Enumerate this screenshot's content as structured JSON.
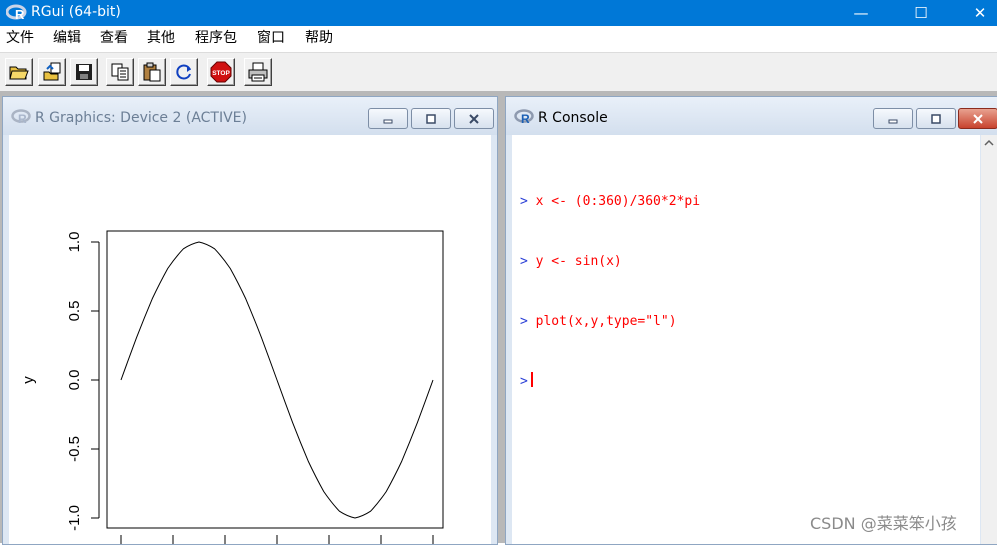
{
  "app": {
    "title": "RGui (64-bit)",
    "controls": {
      "minimize": "—",
      "maximize": "☐",
      "close": "✕"
    }
  },
  "menu": [
    {
      "label": "文件"
    },
    {
      "label": "编辑"
    },
    {
      "label": "查看"
    },
    {
      "label": "其他"
    },
    {
      "label": "程序包"
    },
    {
      "label": "窗口"
    },
    {
      "label": "帮助"
    }
  ],
  "toolbar": [
    {
      "icon": "open-script-icon"
    },
    {
      "icon": "load-workspace-icon"
    },
    {
      "icon": "save-icon"
    },
    {
      "icon": "copy-icon"
    },
    {
      "icon": "paste-icon"
    },
    {
      "icon": "refresh-icon"
    },
    {
      "icon": "stop-icon",
      "label": "STOP"
    },
    {
      "icon": "print-icon"
    }
  ],
  "graphics_window": {
    "title": "R Graphics: Device 2 (ACTIVE)"
  },
  "console_window": {
    "title": "R Console",
    "lines": [
      {
        "prompt": ">",
        "text": "x <- (0:360)/360*2*pi"
      },
      {
        "prompt": ">",
        "text": "y <- sin(x)"
      },
      {
        "prompt": ">",
        "text": "plot(x,y,type=\"l\")"
      },
      {
        "prompt": ">",
        "text": ""
      }
    ]
  },
  "watermark": "CSDN @菜菜笨小孩",
  "colors": {
    "titlebar": "#0078d7",
    "prompt": "#2a3fd6",
    "command": "#ff0000",
    "stop": "#d01010"
  },
  "chart_data": {
    "type": "line",
    "ylabel": "y",
    "ylim": [
      -1.0,
      1.0
    ],
    "yticks": [
      "-1.0",
      "-0.5",
      "0.0",
      "0.5",
      "1.0"
    ],
    "xlim": [
      0,
      6.283
    ],
    "xtick_count": 7,
    "series": [
      {
        "x": [
          0,
          0.314,
          0.628,
          0.942,
          1.257,
          1.571,
          1.885,
          2.199,
          2.513,
          2.827,
          3.142,
          3.456,
          3.77,
          4.084,
          4.398,
          4.712,
          5.027,
          5.341,
          5.655,
          5.969,
          6.283
        ],
        "y": [
          0,
          0.309,
          0.588,
          0.809,
          0.951,
          1.0,
          0.951,
          0.809,
          0.588,
          0.309,
          0,
          -0.309,
          -0.588,
          -0.809,
          -0.951,
          -1.0,
          -0.951,
          -0.809,
          -0.588,
          -0.309,
          0
        ]
      }
    ]
  }
}
